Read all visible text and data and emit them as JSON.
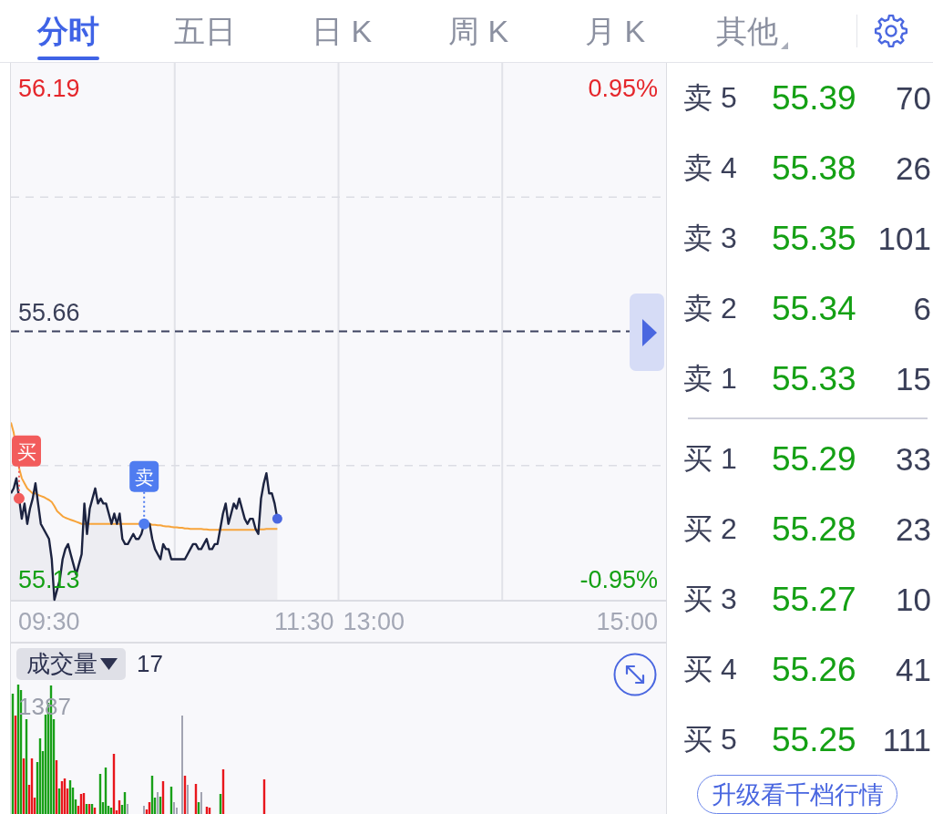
{
  "tabs": [
    {
      "label": "分时",
      "kind": "tab",
      "selected": true
    },
    {
      "label": "五日",
      "kind": "tab",
      "selected": false
    },
    {
      "label": "日 K",
      "kind": "tab",
      "selected": false
    },
    {
      "label": "周 K",
      "kind": "tab",
      "selected": false
    },
    {
      "label": "月 K",
      "kind": "tab",
      "selected": false
    },
    {
      "label": "其他",
      "kind": "dropdown",
      "selected": false
    }
  ],
  "price_chart": {
    "price_labels": [
      {
        "text": "56.19",
        "color": "#e5262b"
      },
      {
        "text": "55.66",
        "color": "#3a3f58"
      },
      {
        "text": "55.13",
        "color": "#14a014"
      }
    ],
    "change_labels": [
      {
        "text": "0.95%",
        "color": "#e5262b"
      },
      {
        "text": "-0.95%",
        "color": "#14a014"
      }
    ],
    "trade_marks": [
      {
        "kind": "buy",
        "text": "买"
      },
      {
        "kind": "sell",
        "text": "卖"
      }
    ],
    "time_labels": [
      "09:30",
      "11:30",
      "13:00",
      "15:00"
    ]
  },
  "volume_panel": {
    "indicator": "成交量",
    "current_value": "17",
    "max_label": "1387"
  },
  "order_book": {
    "asks": [
      {
        "label": "卖 5",
        "price": "55.39",
        "volume": "70",
        "rising": false
      },
      {
        "label": "卖 4",
        "price": "55.38",
        "volume": "26",
        "rising": false
      },
      {
        "label": "卖 3",
        "price": "55.35",
        "volume": "101",
        "rising": false
      },
      {
        "label": "卖 2",
        "price": "55.34",
        "volume": "6",
        "rising": false
      },
      {
        "label": "卖 1",
        "price": "55.33",
        "volume": "15",
        "rising": false
      }
    ],
    "bids": [
      {
        "label": "买 1",
        "price": "55.29",
        "volume": "33",
        "rising": false
      },
      {
        "label": "买 2",
        "price": "55.28",
        "volume": "23",
        "rising": false
      },
      {
        "label": "买 3",
        "price": "55.27",
        "volume": "10",
        "rising": false
      },
      {
        "label": "买 4",
        "price": "55.26",
        "volume": "41",
        "rising": false
      },
      {
        "label": "买 5",
        "price": "55.25",
        "volume": "111",
        "rising": false
      }
    ],
    "upgrade_button": "升级看千档行情"
  }
}
